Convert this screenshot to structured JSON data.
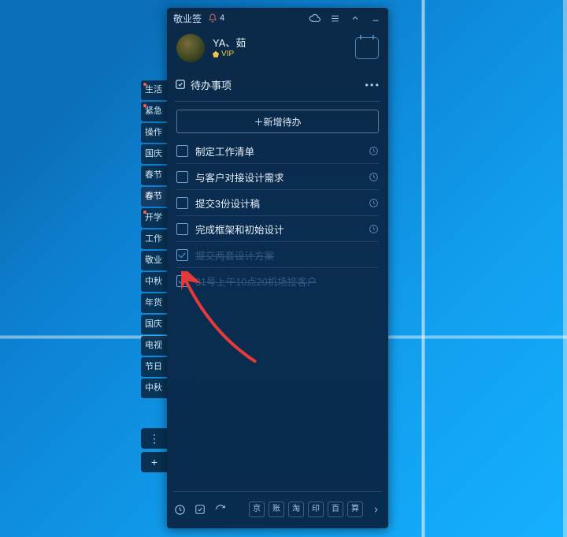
{
  "titlebar": {
    "app_name": "敬业签",
    "notification_count": "4"
  },
  "user": {
    "name": "YA、茹",
    "vip_label": "VIP"
  },
  "section": {
    "title": "待办事项",
    "more_label": "•••"
  },
  "add_button": "＋新增待办",
  "todos": [
    {
      "text": "制定工作清单",
      "done": false,
      "has_clock": true
    },
    {
      "text": "与客户对接设计需求",
      "done": false,
      "has_clock": true
    },
    {
      "text": "提交3份设计稿",
      "done": false,
      "has_clock": true
    },
    {
      "text": "完成框架和初始设计",
      "done": false,
      "has_clock": true
    },
    {
      "text": "提交两套设计方案",
      "done": true,
      "has_clock": false
    },
    {
      "text": "31号上午10点20机场接客户",
      "done": true,
      "has_clock": false
    }
  ],
  "side_tabs": [
    {
      "label": "生活",
      "dot": true
    },
    {
      "label": "紧急",
      "dot": true
    },
    {
      "label": "操作",
      "dot": false
    },
    {
      "label": "国庆",
      "dot": false
    },
    {
      "label": "春节",
      "dot": false
    },
    {
      "label": "春节",
      "dot": false,
      "selected": true
    },
    {
      "label": "开学",
      "dot": true
    },
    {
      "label": "工作",
      "dot": false
    },
    {
      "label": "敬业",
      "dot": false
    },
    {
      "label": "中秋",
      "dot": false
    },
    {
      "label": "年货",
      "dot": false
    },
    {
      "label": "国庆",
      "dot": false
    },
    {
      "label": "电视",
      "dot": false
    },
    {
      "label": "节日",
      "dot": false
    },
    {
      "label": "中秋",
      "dot": false
    }
  ],
  "side_extra": {
    "more": "⋮",
    "add": "+"
  },
  "bottom_chips": [
    "京",
    "账",
    "淘",
    "印",
    "百",
    "算"
  ],
  "icons": {
    "bell": "bell-icon",
    "cloud": "cloud-sync-icon",
    "menu": "hamburger-icon",
    "up": "chevron-up-icon",
    "min": "minimize-icon",
    "calendar": "calendar-icon",
    "check_title": "todo-check-icon",
    "clock": "clock-icon",
    "bb_clock": "clock-icon",
    "bb_check": "checkbox-icon",
    "bb_refresh": "refresh-icon",
    "bb_chevron": "chevron-right-icon"
  }
}
